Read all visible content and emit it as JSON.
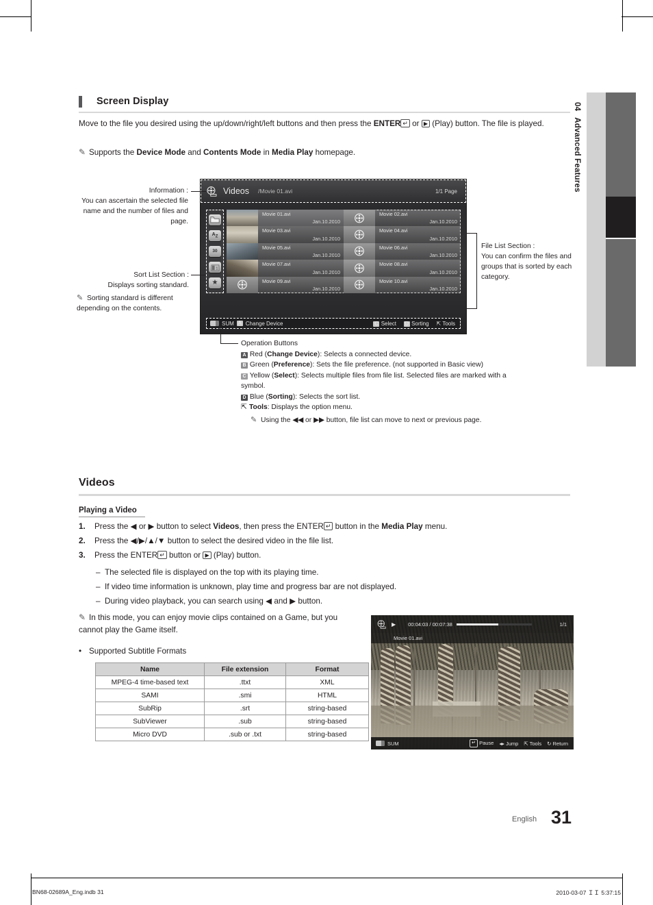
{
  "chapter_tab": {
    "number": "04",
    "title": "Advanced Features"
  },
  "sections": {
    "screen_display": {
      "heading": "Screen Display",
      "paragraph_1_a": "Move to the file you desired using the up/down/right/left buttons and then press the ",
      "enter_label": "ENTER",
      "paragraph_1_b": " or ",
      "paragraph_1_c": " (Play) button. The file is played.",
      "note_a": "Supports the ",
      "note_b": "Device Mode",
      "note_c": " and ",
      "note_d": "Contents Mode",
      "note_e": " in ",
      "note_f": "Media Play",
      "note_g": " homepage."
    },
    "videos": {
      "heading": "Videos",
      "subheading": "Playing a Video",
      "steps": [
        {
          "num": "1.",
          "a": "Press the ",
          "b": "◀ or ▶",
          "c": " button to select ",
          "d": "Videos",
          "e": ", then press the ",
          "f": "ENTER",
          "g": " button in the ",
          "h": "Media Play",
          "i": " menu."
        },
        {
          "num": "2.",
          "a": "Press the ",
          "b": "◀/▶/▲/▼",
          "c": " button to select the desired video in the file list."
        },
        {
          "num": "3.",
          "a": "Press the ",
          "b": "ENTER",
          "c": " button or ",
          "d": " (Play) button."
        }
      ],
      "dashes": [
        "The selected file is displayed on the top with its playing time.",
        "If video time information is unknown, play time and progress bar are not displayed.",
        "During video playback, you can search using ◀ and ▶ button."
      ],
      "note": "In this mode, you can enjoy movie clips contained on a Game, but you cannot play the Game itself.",
      "bullet": "Supported Subtitle Formats"
    }
  },
  "annotations": {
    "information": {
      "title": "Information :",
      "text": "You can ascertain the selected file name and the number of files and page."
    },
    "sort_list": {
      "title": "Sort List Section :",
      "text": "Displays sorting standard."
    },
    "sort_note": "Sorting standard is different depending on the contents.",
    "file_list": {
      "title": "File List Section :",
      "text": "You can confirm the files and groups that is sorted by each category."
    },
    "operation": {
      "title": "Operation Buttons",
      "items": [
        {
          "key": "A",
          "color": "r",
          "a": "Red (",
          "b": "Change Device",
          "c": "): Selects a connected device."
        },
        {
          "key": "B",
          "color": "g",
          "a": "Green (",
          "b": "Preference",
          "c": "): Sets the file preference. (not supported in Basic view)"
        },
        {
          "key": "C",
          "color": "y",
          "a": "Yellow (",
          "b": "Select",
          "c": "): Selects multiple files from file list. Selected files are marked with a symbol."
        },
        {
          "key": "D",
          "color": "b",
          "a": "Blue (",
          "b": "Sorting",
          "c": "): Selects the sort list."
        },
        {
          "key": "T",
          "color": "t",
          "a": "",
          "b": "Tools",
          "c": ": Displays the option menu."
        }
      ],
      "note": "Using the ◀◀ or ▶▶ button, file list can move to next or previous page."
    }
  },
  "tv_screen": {
    "title": "Videos",
    "path": "/Movie 01.avi",
    "page": "1/1 Page",
    "sort_icons": [
      "folder-icon",
      "alphabetical-az-icon",
      "calendar-30-icon",
      "chapter-icon",
      "favorite-star-icon"
    ],
    "files": [
      {
        "name": "Movie 01.avi",
        "date": "Jan.10.2010",
        "selected": true,
        "thumb": "photo"
      },
      {
        "name": "Movie 02.avi",
        "date": "Jan.10.2010",
        "selected": false,
        "thumb": "reel"
      },
      {
        "name": "Movie 03.avi",
        "date": "Jan.10.2010",
        "selected": false,
        "thumb": "photo"
      },
      {
        "name": "Movie 04.avi",
        "date": "Jan.10.2010",
        "selected": false,
        "thumb": "reel"
      },
      {
        "name": "Movie 05.avi",
        "date": "Jan.10.2010",
        "selected": false,
        "thumb": "photo"
      },
      {
        "name": "Movie 06.avi",
        "date": "Jan.10.2010",
        "selected": false,
        "thumb": "reel"
      },
      {
        "name": "Movie 07.avi",
        "date": "Jan.10.2010",
        "selected": false,
        "thumb": "photo"
      },
      {
        "name": "Movie 08.avi",
        "date": "Jan.10.2010",
        "selected": false,
        "thumb": "reel"
      },
      {
        "name": "Movie 09.avi",
        "date": "Jan.10.2010",
        "selected": false,
        "thumb": "reel"
      },
      {
        "name": "Movie 10.avi",
        "date": "Jan.10.2010",
        "selected": false,
        "thumb": "reel"
      }
    ],
    "op_bar": {
      "sum": "SUM",
      "a_key": "A",
      "change_device": "Change Device",
      "c_key": "C",
      "select": "Select",
      "d_key": "D",
      "sorting": "Sorting",
      "tools": "Tools"
    }
  },
  "player_screen": {
    "time": "00:04:03 / 00:07:38",
    "page": "1/1",
    "filename": "Movie 01.avi",
    "sum": "SUM",
    "pause": "Pause",
    "jump": "Jump",
    "tools": "Tools",
    "return": "Return",
    "progress_percent": 56
  },
  "subtitle_table": {
    "headers": [
      "Name",
      "File extension",
      "Format"
    ],
    "rows": [
      [
        "MPEG-4 time-based text",
        ".ttxt",
        "XML"
      ],
      [
        "SAMI",
        ".smi",
        "HTML"
      ],
      [
        "SubRip",
        ".srt",
        "string-based"
      ],
      [
        "SubViewer",
        ".sub",
        "string-based"
      ],
      [
        "Micro DVD",
        ".sub or .txt",
        "string-based"
      ]
    ]
  },
  "footer": {
    "language": "English",
    "page_number": "31",
    "left": "BN68-02689A_Eng.indb   31",
    "right": "2010-03-07   ＩＩ 5:37:15"
  }
}
